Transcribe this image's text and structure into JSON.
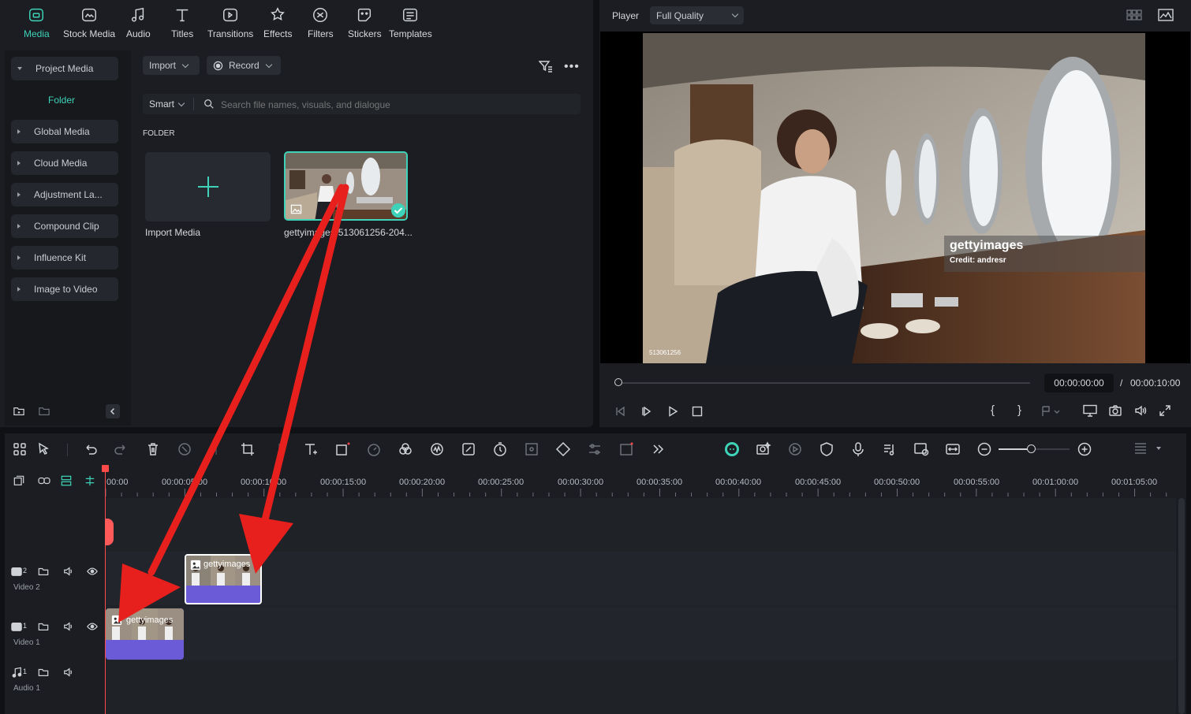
{
  "top_tabs": [
    {
      "label": "Media",
      "icon": "media-icon",
      "active": true
    },
    {
      "label": "Stock Media",
      "icon": "stock-media-icon"
    },
    {
      "label": "Audio",
      "icon": "audio-icon"
    },
    {
      "label": "Titles",
      "icon": "titles-icon"
    },
    {
      "label": "Transitions",
      "icon": "transitions-icon"
    },
    {
      "label": "Effects",
      "icon": "effects-icon"
    },
    {
      "label": "Filters",
      "icon": "filters-icon"
    },
    {
      "label": "Stickers",
      "icon": "stickers-icon"
    },
    {
      "label": "Templates",
      "icon": "templates-icon"
    }
  ],
  "sidebar": {
    "items": [
      {
        "label": "Project Media"
      },
      {
        "label": "Folder"
      },
      {
        "label": "Global Media"
      },
      {
        "label": "Cloud Media"
      },
      {
        "label": "Adjustment La..."
      },
      {
        "label": "Compound Clip"
      },
      {
        "label": "Influence Kit"
      },
      {
        "label": "Image to Video"
      }
    ]
  },
  "media_toolbar": {
    "import_label": "Import",
    "record_label": "Record",
    "smart_label": "Smart",
    "search_placeholder": "Search file names, visuals, and dialogue",
    "folder_heading": "FOLDER"
  },
  "media_items": [
    {
      "label": "Import Media"
    },
    {
      "label": "gettyimages-513061256-204..."
    }
  ],
  "player": {
    "label": "Player",
    "quality": "Full Quality",
    "watermark_brand": "gettyimages",
    "watermark_credit": "Credit: andresr",
    "image_id": "513061256",
    "current_time": "00:00:00:00",
    "separator": "/",
    "total_time": "00:00:10:00",
    "progress": 0
  },
  "timeline": {
    "ruler": [
      "00:00",
      "00:00:05:00",
      "00:00:10:00",
      "00:00:15:00",
      "00:00:20:00",
      "00:00:25:00",
      "00:00:30:00",
      "00:00:35:00",
      "00:00:40:00",
      "00:00:45:00",
      "00:00:50:00",
      "00:00:55:00",
      "00:01:00:00",
      "00:01:05:00"
    ],
    "tracks": [
      {
        "label": "Video 2",
        "num": "2"
      },
      {
        "label": "Video 1",
        "num": "1"
      },
      {
        "label": "Audio 1",
        "num": "1"
      }
    ],
    "clip_label": "gettyimages",
    "zoom_level": 0.5
  },
  "colors": {
    "accent": "#3ed3b8",
    "clip": "#6b5bd6",
    "playhead": "#ff4a4a",
    "arrow": "#e8201d"
  }
}
